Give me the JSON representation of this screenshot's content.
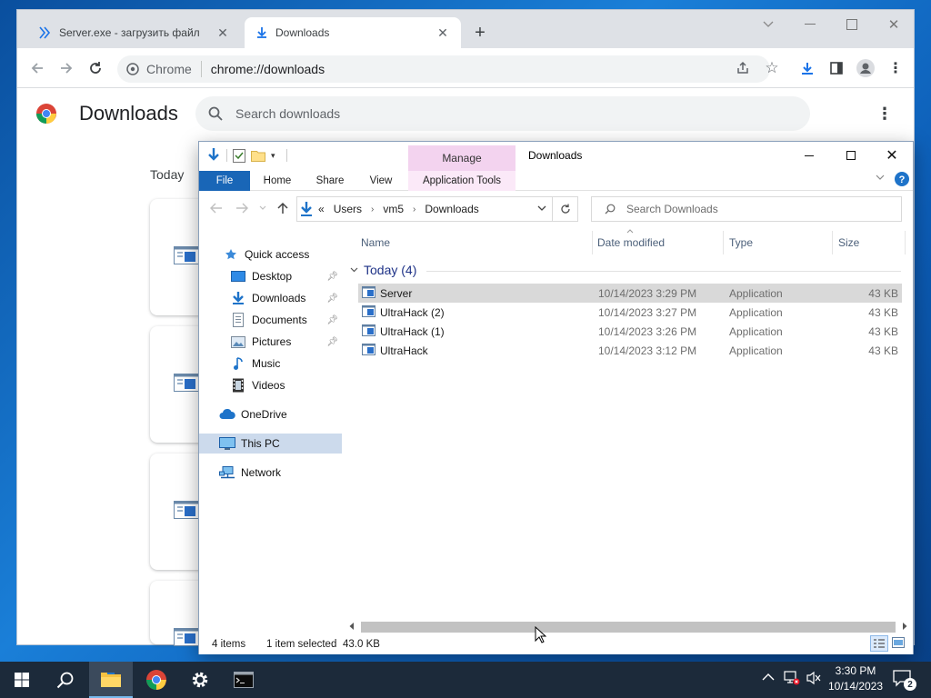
{
  "browser": {
    "tabs": [
      {
        "label": "Server.exe - загрузить файл",
        "active": false
      },
      {
        "label": "Downloads",
        "active": true
      }
    ],
    "omnibox": {
      "origin": "Chrome",
      "url": "chrome://downloads"
    },
    "page": {
      "title": "Downloads",
      "search_placeholder": "Search downloads",
      "group_label": "Today"
    }
  },
  "explorer": {
    "context_tab": "Manage",
    "title": "Downloads",
    "ribbon_tabs": {
      "file": "File",
      "home": "Home",
      "share": "Share",
      "view": "View",
      "app_tools": "Application Tools"
    },
    "address": {
      "overflow": "«",
      "segments": [
        "Users",
        "vm5",
        "Downloads"
      ]
    },
    "search_placeholder": "Search Downloads",
    "nav": {
      "quick_access": "Quick access",
      "desktop": "Desktop",
      "downloads": "Downloads",
      "documents": "Documents",
      "pictures": "Pictures",
      "music": "Music",
      "videos": "Videos",
      "onedrive": "OneDrive",
      "this_pc": "This PC",
      "network": "Network"
    },
    "columns": {
      "name": "Name",
      "date": "Date modified",
      "type": "Type",
      "size": "Size"
    },
    "group": "Today (4)",
    "files": [
      {
        "name": "Server",
        "date": "10/14/2023 3:29 PM",
        "type": "Application",
        "size": "43 KB",
        "selected": true
      },
      {
        "name": "UltraHack (2)",
        "date": "10/14/2023 3:27 PM",
        "type": "Application",
        "size": "43 KB",
        "selected": false
      },
      {
        "name": "UltraHack (1)",
        "date": "10/14/2023 3:26 PM",
        "type": "Application",
        "size": "43 KB",
        "selected": false
      },
      {
        "name": "UltraHack",
        "date": "10/14/2023 3:12 PM",
        "type": "Application",
        "size": "43 KB",
        "selected": false
      }
    ],
    "status": {
      "count": "4 items",
      "selected": "1 item selected",
      "size": "43.0 KB"
    }
  },
  "taskbar": {
    "time": "3:30 PM",
    "date": "10/14/2023",
    "notification_count": "2"
  },
  "colors": {
    "file_tab": "#1966b7",
    "manage_tab": "#f3d3ef",
    "selection": "#d9d9d9",
    "group_header": "#1e3287"
  }
}
